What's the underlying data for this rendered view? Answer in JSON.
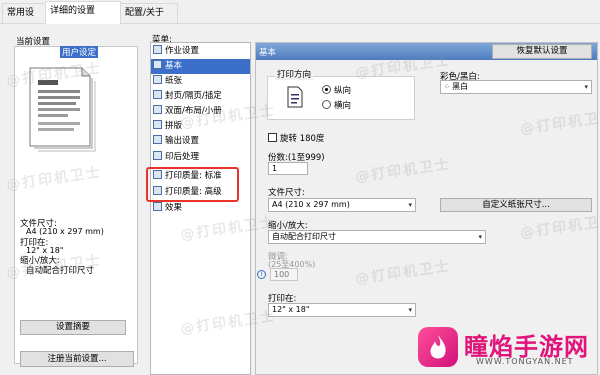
{
  "tabs": [
    "常用设置",
    "详细的设置",
    "配置/关于"
  ],
  "left": {
    "current_label": "当前设置",
    "preview_title": "用户设定",
    "paper_size_label": "文件尺寸:",
    "paper_size_value": "A4 (210 x 297 mm)",
    "print_on_label": "打印在:",
    "print_on_value": "12\" x 18\"",
    "zoom_label": "缩小/放大:",
    "zoom_value": "自动配合打印尺寸",
    "summary_button": "设置摘要",
    "register_button": "注册当前设置..."
  },
  "menu": {
    "label": "菜单:",
    "items": [
      "作业设置",
      "基本",
      "纸张",
      "封页/隔页/插定",
      "双面/布局/小册",
      "拼版",
      "输出设置",
      "印后处理",
      "打印质量: 标准",
      "打印质量: 高级",
      "效果"
    ],
    "selected_index": 1,
    "highlight_color": "#e8332a"
  },
  "main": {
    "header": "基本",
    "restore_button": "恢复默认设置",
    "orientation_label": "打印方向",
    "portrait": "纵向",
    "landscape": "横向",
    "color_label": "彩色/黑白:",
    "color_value": "黑白",
    "rotate_label": "旋转 180度",
    "copies_label": "份数:(1至999)",
    "copies_value": "1",
    "doc_size_label": "文件尺寸:",
    "doc_size_value": "A4 (210 x 297 mm)",
    "custom_size_button": "自定义纸张尺寸...",
    "zoom_label": "缩小/放大:",
    "zoom_value": "自动配合打印尺寸",
    "adjust_label": "微调:",
    "adjust_range": "(25至400%)",
    "adjust_value": "100",
    "print_on_label": "打印在:",
    "print_on_value": "12\" x 18\""
  },
  "watermark": {
    "text": "@打印机卫士",
    "logo_text": "瞳焰手游网",
    "logo_url": "WWW.TONGYAN.NET"
  }
}
